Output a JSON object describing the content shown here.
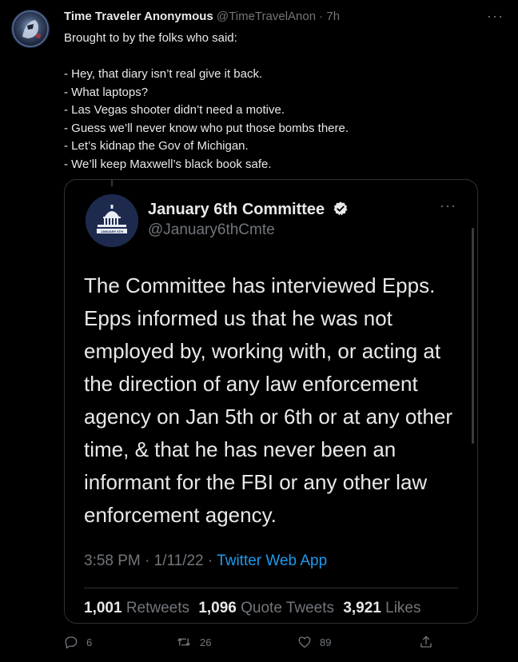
{
  "tweet": {
    "author_name": "Time Traveler Anonymous",
    "author_handle": "@TimeTravelAnon",
    "separator": " · ",
    "time": "7h",
    "more_label": "···",
    "lines": [
      "Brought to by the folks who said:",
      "",
      "- Hey, that diary isn’t real give it back.",
      "- What laptops?",
      "- Las Vegas shooter didn’t need a motive.",
      "- Guess we’ll never know who put those bombs there.",
      "- Let’s kidnap the Gov of Michigan.",
      "- We’ll keep Maxwell’s black book safe."
    ]
  },
  "quoted": {
    "author_name": "January 6th Committee",
    "author_handle": "@January6thCmte",
    "avatar_caption": "JANUARY 6TH",
    "more_label": "···",
    "text": "The Committee has interviewed Epps. Epps informed us that he was not employed by, working with, or acting at the direction of any law enforcement agency on Jan 5th or 6th or at any other time, & that he has never been an informant for the FBI or any other law enforcement agency.",
    "timestamp": "3:58 PM · 1/11/22 · ",
    "source": "Twitter Web App",
    "stats": {
      "retweets_count": "1,001",
      "retweets_label": "Retweets",
      "quotes_count": "1,096",
      "quotes_label": "Quote Tweets",
      "likes_count": "3,921",
      "likes_label": "Likes"
    }
  },
  "actions": {
    "reply_count": "6",
    "retweet_count": "26",
    "like_count": "89"
  },
  "colors": {
    "background": "#000000",
    "text": "#e7e9ea",
    "muted": "#71767b",
    "link": "#1d9bf0",
    "border": "#2f3336"
  }
}
